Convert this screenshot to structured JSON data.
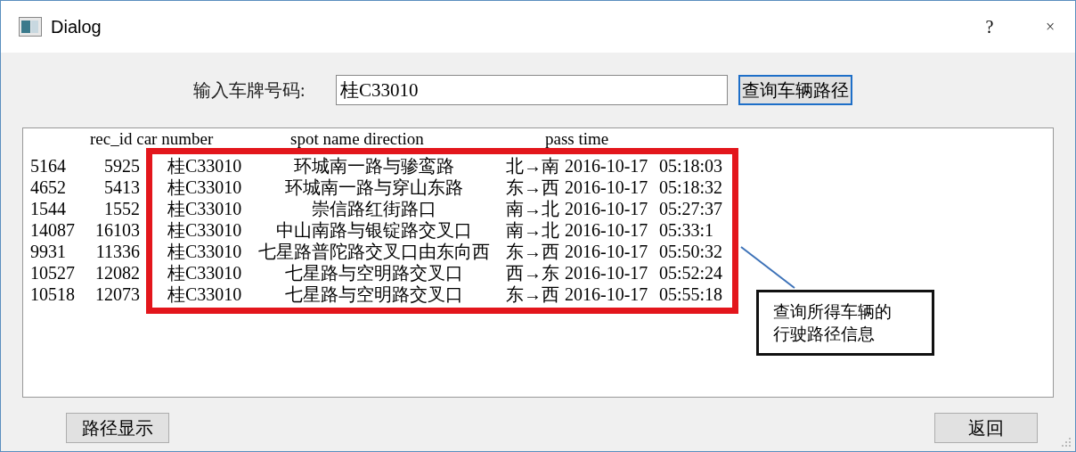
{
  "window": {
    "title": "Dialog",
    "help": "?",
    "close": "×"
  },
  "plate": {
    "label": "输入车牌号码:",
    "value": "桂C33010"
  },
  "query_button": "查询车辆路径",
  "result": {
    "header": [
      "rec_id car number",
      "spot name direction",
      "pass time"
    ],
    "rows": [
      {
        "id": "5164",
        "rec_id": "5925",
        "car": "桂C33010",
        "spot": "环城南一路与骖鸾路",
        "direction": "北→南",
        "date": "2016-10-17",
        "time": "05:18:03"
      },
      {
        "id": "4652",
        "rec_id": "5413",
        "car": "桂C33010",
        "spot": "环城南一路与穿山东路",
        "direction": "东→西",
        "date": "2016-10-17",
        "time": "05:18:32"
      },
      {
        "id": "1544",
        "rec_id": "1552",
        "car": "桂C33010",
        "spot": "崇信路红街路口",
        "direction": "南→北",
        "date": "2016-10-17",
        "time": "05:27:37"
      },
      {
        "id": "14087",
        "rec_id": "16103",
        "car": "桂C33010",
        "spot": "中山南路与银锭路交叉口",
        "direction": "南→北",
        "date": "2016-10-17",
        "time": "05:33:1"
      },
      {
        "id": "9931",
        "rec_id": "11336",
        "car": "桂C33010",
        "spot": "七星路普陀路交叉口由东向西",
        "direction": "东→西",
        "date": "2016-10-17",
        "time": "05:50:32"
      },
      {
        "id": "10527",
        "rec_id": "12082",
        "car": "桂C33010",
        "spot": "七星路与空明路交叉口",
        "direction": "西→东",
        "date": "2016-10-17",
        "time": "05:52:24"
      },
      {
        "id": "10518",
        "rec_id": "12073",
        "car": "桂C33010",
        "spot": "七星路与空明路交叉口",
        "direction": "东→西",
        "date": "2016-10-17",
        "time": "05:55:18"
      }
    ]
  },
  "annotation": [
    "查询所得车辆的",
    "行驶路径信息"
  ],
  "buttons": [
    "路径显示",
    "返回"
  ]
}
